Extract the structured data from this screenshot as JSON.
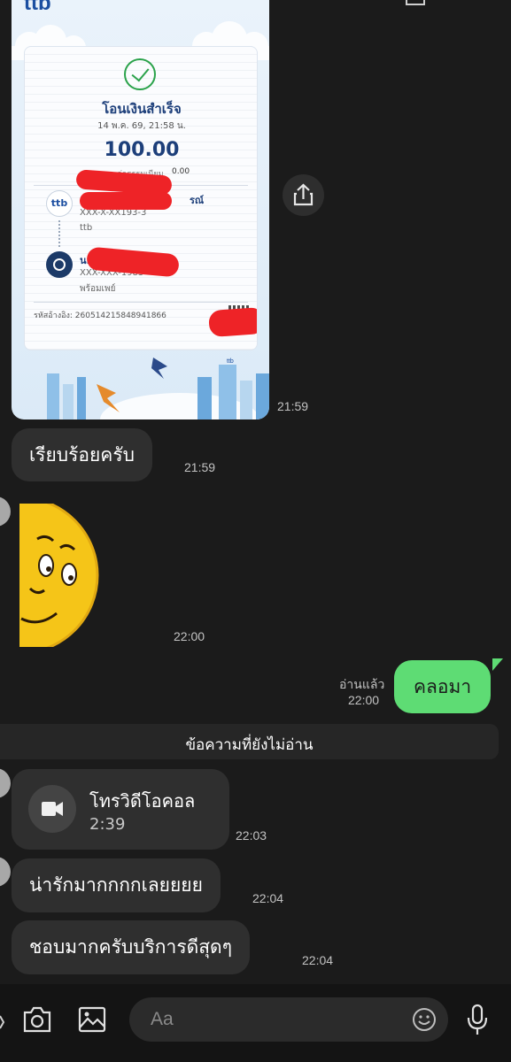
{
  "slip": {
    "logo": "ttb",
    "title": "โอนเงินสำเร็จ",
    "date": "14 พ.ค. 69, 21:58 น.",
    "amount": "100.00",
    "fee_label": "ค่าธรรมเนียม",
    "fee": "0.00",
    "sender_name": "รณ์",
    "sender_acct": "XXX-X-XX193-3",
    "sender_bank": "ttb",
    "sender_icon_text": "ttb",
    "receiver_name": "น.ส",
    "receiver_acct": "XXX-XXX-1983",
    "receiver_bank": "พร้อมเพย์",
    "ref": "รหัสอ้างอิง: 260514215848941866",
    "footer_logo": "ttb"
  },
  "messages": {
    "slip_time": "21:59",
    "msg1": "เรียบร้อยครับ",
    "msg1_time": "21:59",
    "sticker_time": "22:00",
    "my_read": "อ่านแล้ว",
    "my_time": "22:00",
    "my_msg": "คลอมา",
    "unread_divider": "ข้อความที่ยังไม่อ่าน",
    "call_title": "โทรวิดีโอคอล",
    "call_duration": "2:39",
    "call_time": "22:03",
    "msg2": "น่ารักมากกกกเลยยยย",
    "msg2_time": "22:04",
    "msg3": "ชอบมากครับบริการดีสุดๆ",
    "msg3_time": "22:04"
  },
  "input": {
    "placeholder": "Aa"
  },
  "colors": {
    "background": "#1b1b1b",
    "bubble": "#2f2f2f",
    "my_bubble": "#5edc74",
    "redaction": "#ee2327"
  },
  "icons": [
    "share-icon",
    "video-call-icon",
    "camera-icon",
    "gallery-icon",
    "emoji-icon",
    "microphone-icon"
  ]
}
